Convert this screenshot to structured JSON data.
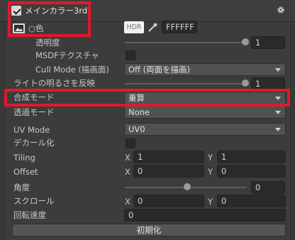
{
  "header": {
    "title": "メインカラー3rd",
    "enabled": true
  },
  "color": {
    "label": "○色",
    "hdr": "HDR",
    "hex": "FFFFFF",
    "swatch": "#ffffff"
  },
  "alpha": {
    "label": "透明度",
    "value": "1"
  },
  "msdf": {
    "label": "MSDFテクスチャ"
  },
  "cull": {
    "label": "Cull Mode (描画面)",
    "value": "Off (両面を描画)"
  },
  "light": {
    "label": "ライトの明るさを反映",
    "value": "1"
  },
  "blend": {
    "label": "合成モード",
    "value": "乗算"
  },
  "trans": {
    "label": "透過モード",
    "value": "None"
  },
  "uvmode": {
    "label": "UV Mode",
    "value": "UV0"
  },
  "decal": {
    "label": "デカール化"
  },
  "tiling": {
    "label": "Tiling",
    "x_label": "X",
    "x": "1",
    "y_label": "Y",
    "y": "1"
  },
  "offset": {
    "label": "Offset",
    "x_label": "X",
    "x": "0",
    "y_label": "Y",
    "y": "0"
  },
  "angle": {
    "label": "角度",
    "value": "0"
  },
  "scroll": {
    "label": "スクロール",
    "x_label": "X",
    "x": "0",
    "y_label": "Y",
    "y": "0"
  },
  "rot": {
    "label": "回転速度",
    "value": "0"
  },
  "reset": {
    "label": "初期化"
  },
  "accent": {
    "highlight": "#e0192b"
  }
}
